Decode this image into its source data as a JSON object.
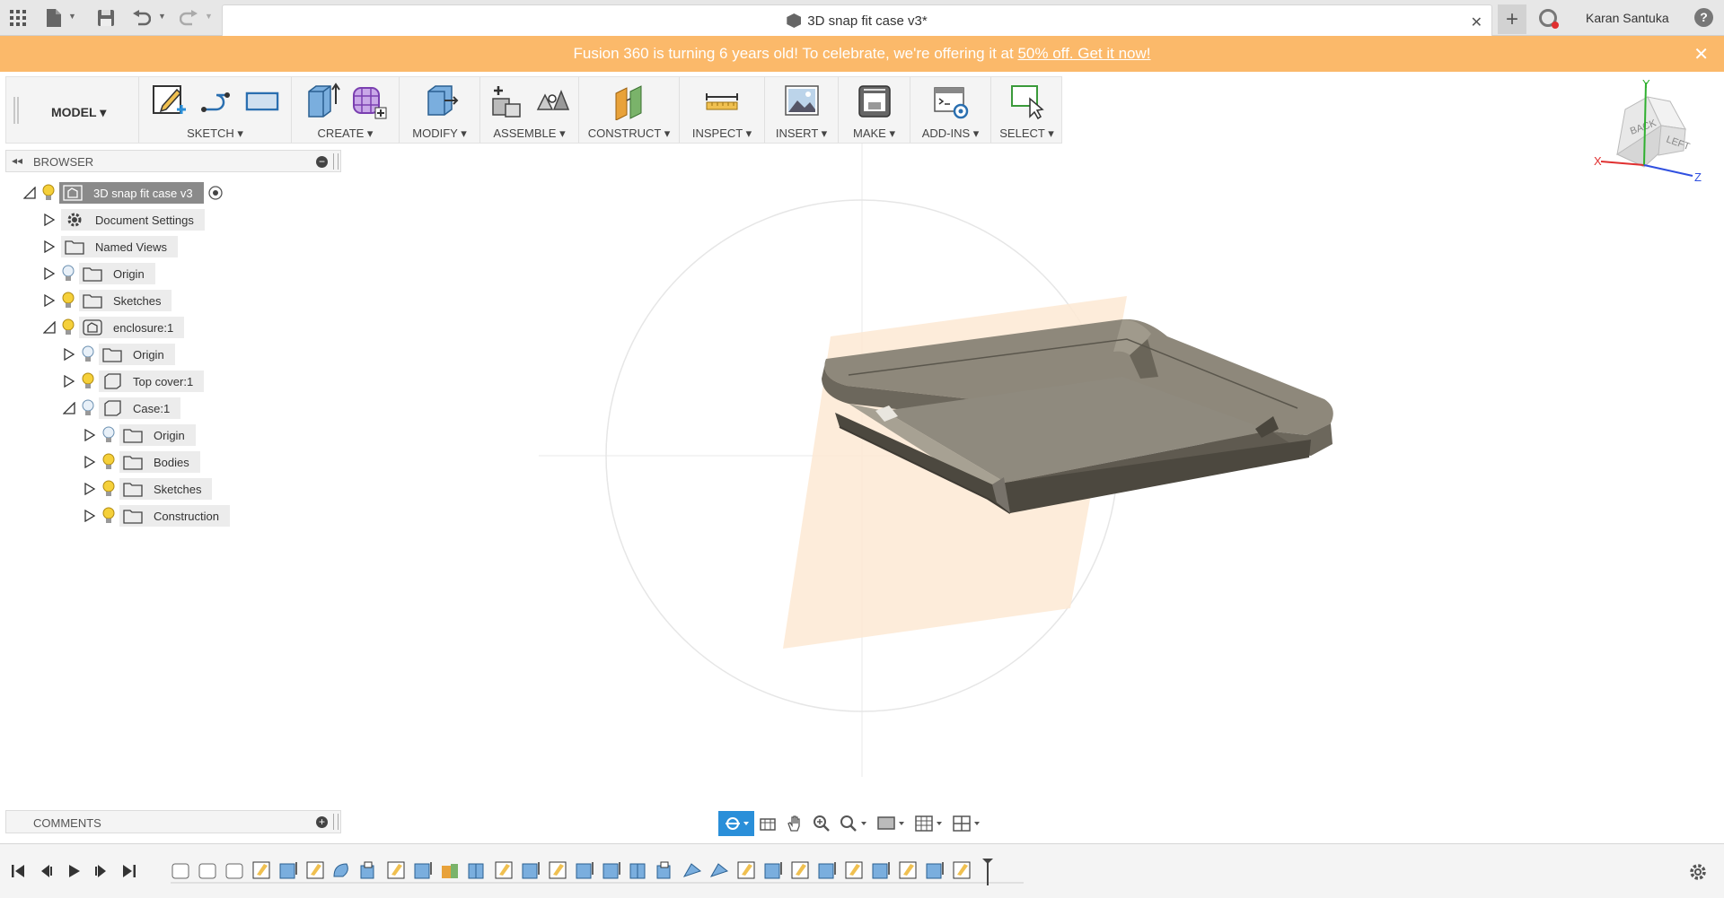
{
  "topbar": {
    "app_grid_icon": "app-grid-icon",
    "file_icon": "file-icon",
    "save_icon": "save-icon",
    "undo_icon": "undo-icon",
    "redo_icon": "redo-icon",
    "document_title": "3D snap fit case v3*",
    "close_tab": "✕",
    "new_tab": "+",
    "user_name": "Karan Santuka",
    "help": "?"
  },
  "banner": {
    "text": "Fusion 360 is turning 6 years old! To celebrate, we're offering it at ",
    "link_text": "50% off. Get it now!",
    "close": "✕",
    "background": "#fbb96a"
  },
  "toolbar": {
    "workspace": "MODEL ▾",
    "groups": [
      {
        "label": "SKETCH ▾"
      },
      {
        "label": "CREATE ▾"
      },
      {
        "label": "MODIFY ▾"
      },
      {
        "label": "ASSEMBLE ▾"
      },
      {
        "label": "CONSTRUCT ▾"
      },
      {
        "label": "INSPECT ▾"
      },
      {
        "label": "INSERT ▾"
      },
      {
        "label": "MAKE ▾"
      },
      {
        "label": "ADD-INS ▾"
      },
      {
        "label": "SELECT ▾"
      }
    ]
  },
  "browser": {
    "title": "BROWSER",
    "items": [
      {
        "label": "3D snap fit case v3",
        "expanded": true
      },
      {
        "label": "Document Settings",
        "expanded": false
      },
      {
        "label": "Named Views",
        "expanded": false
      },
      {
        "label": "Origin",
        "expanded": false
      },
      {
        "label": "Sketches",
        "expanded": false
      },
      {
        "label": "enclosure:1",
        "expanded": true
      },
      {
        "label": "Origin",
        "expanded": false
      },
      {
        "label": "Top cover:1",
        "expanded": false
      },
      {
        "label": "Case:1",
        "expanded": true
      },
      {
        "label": "Origin",
        "expanded": false
      },
      {
        "label": "Bodies",
        "expanded": false
      },
      {
        "label": "Sketches",
        "expanded": false
      },
      {
        "label": "Construction",
        "expanded": false
      }
    ]
  },
  "comments": {
    "title": "COMMENTS"
  },
  "viewcube": {
    "face_back": "BACK",
    "face_left": "LEFT",
    "axis_x": "X",
    "axis_y": "Y",
    "axis_z": "Z"
  },
  "colors": {
    "accent": "#2a8fd9",
    "toolbar_bg": "#f4f4f4",
    "model": "#6f6a5e",
    "plane": "#fde9d4"
  }
}
